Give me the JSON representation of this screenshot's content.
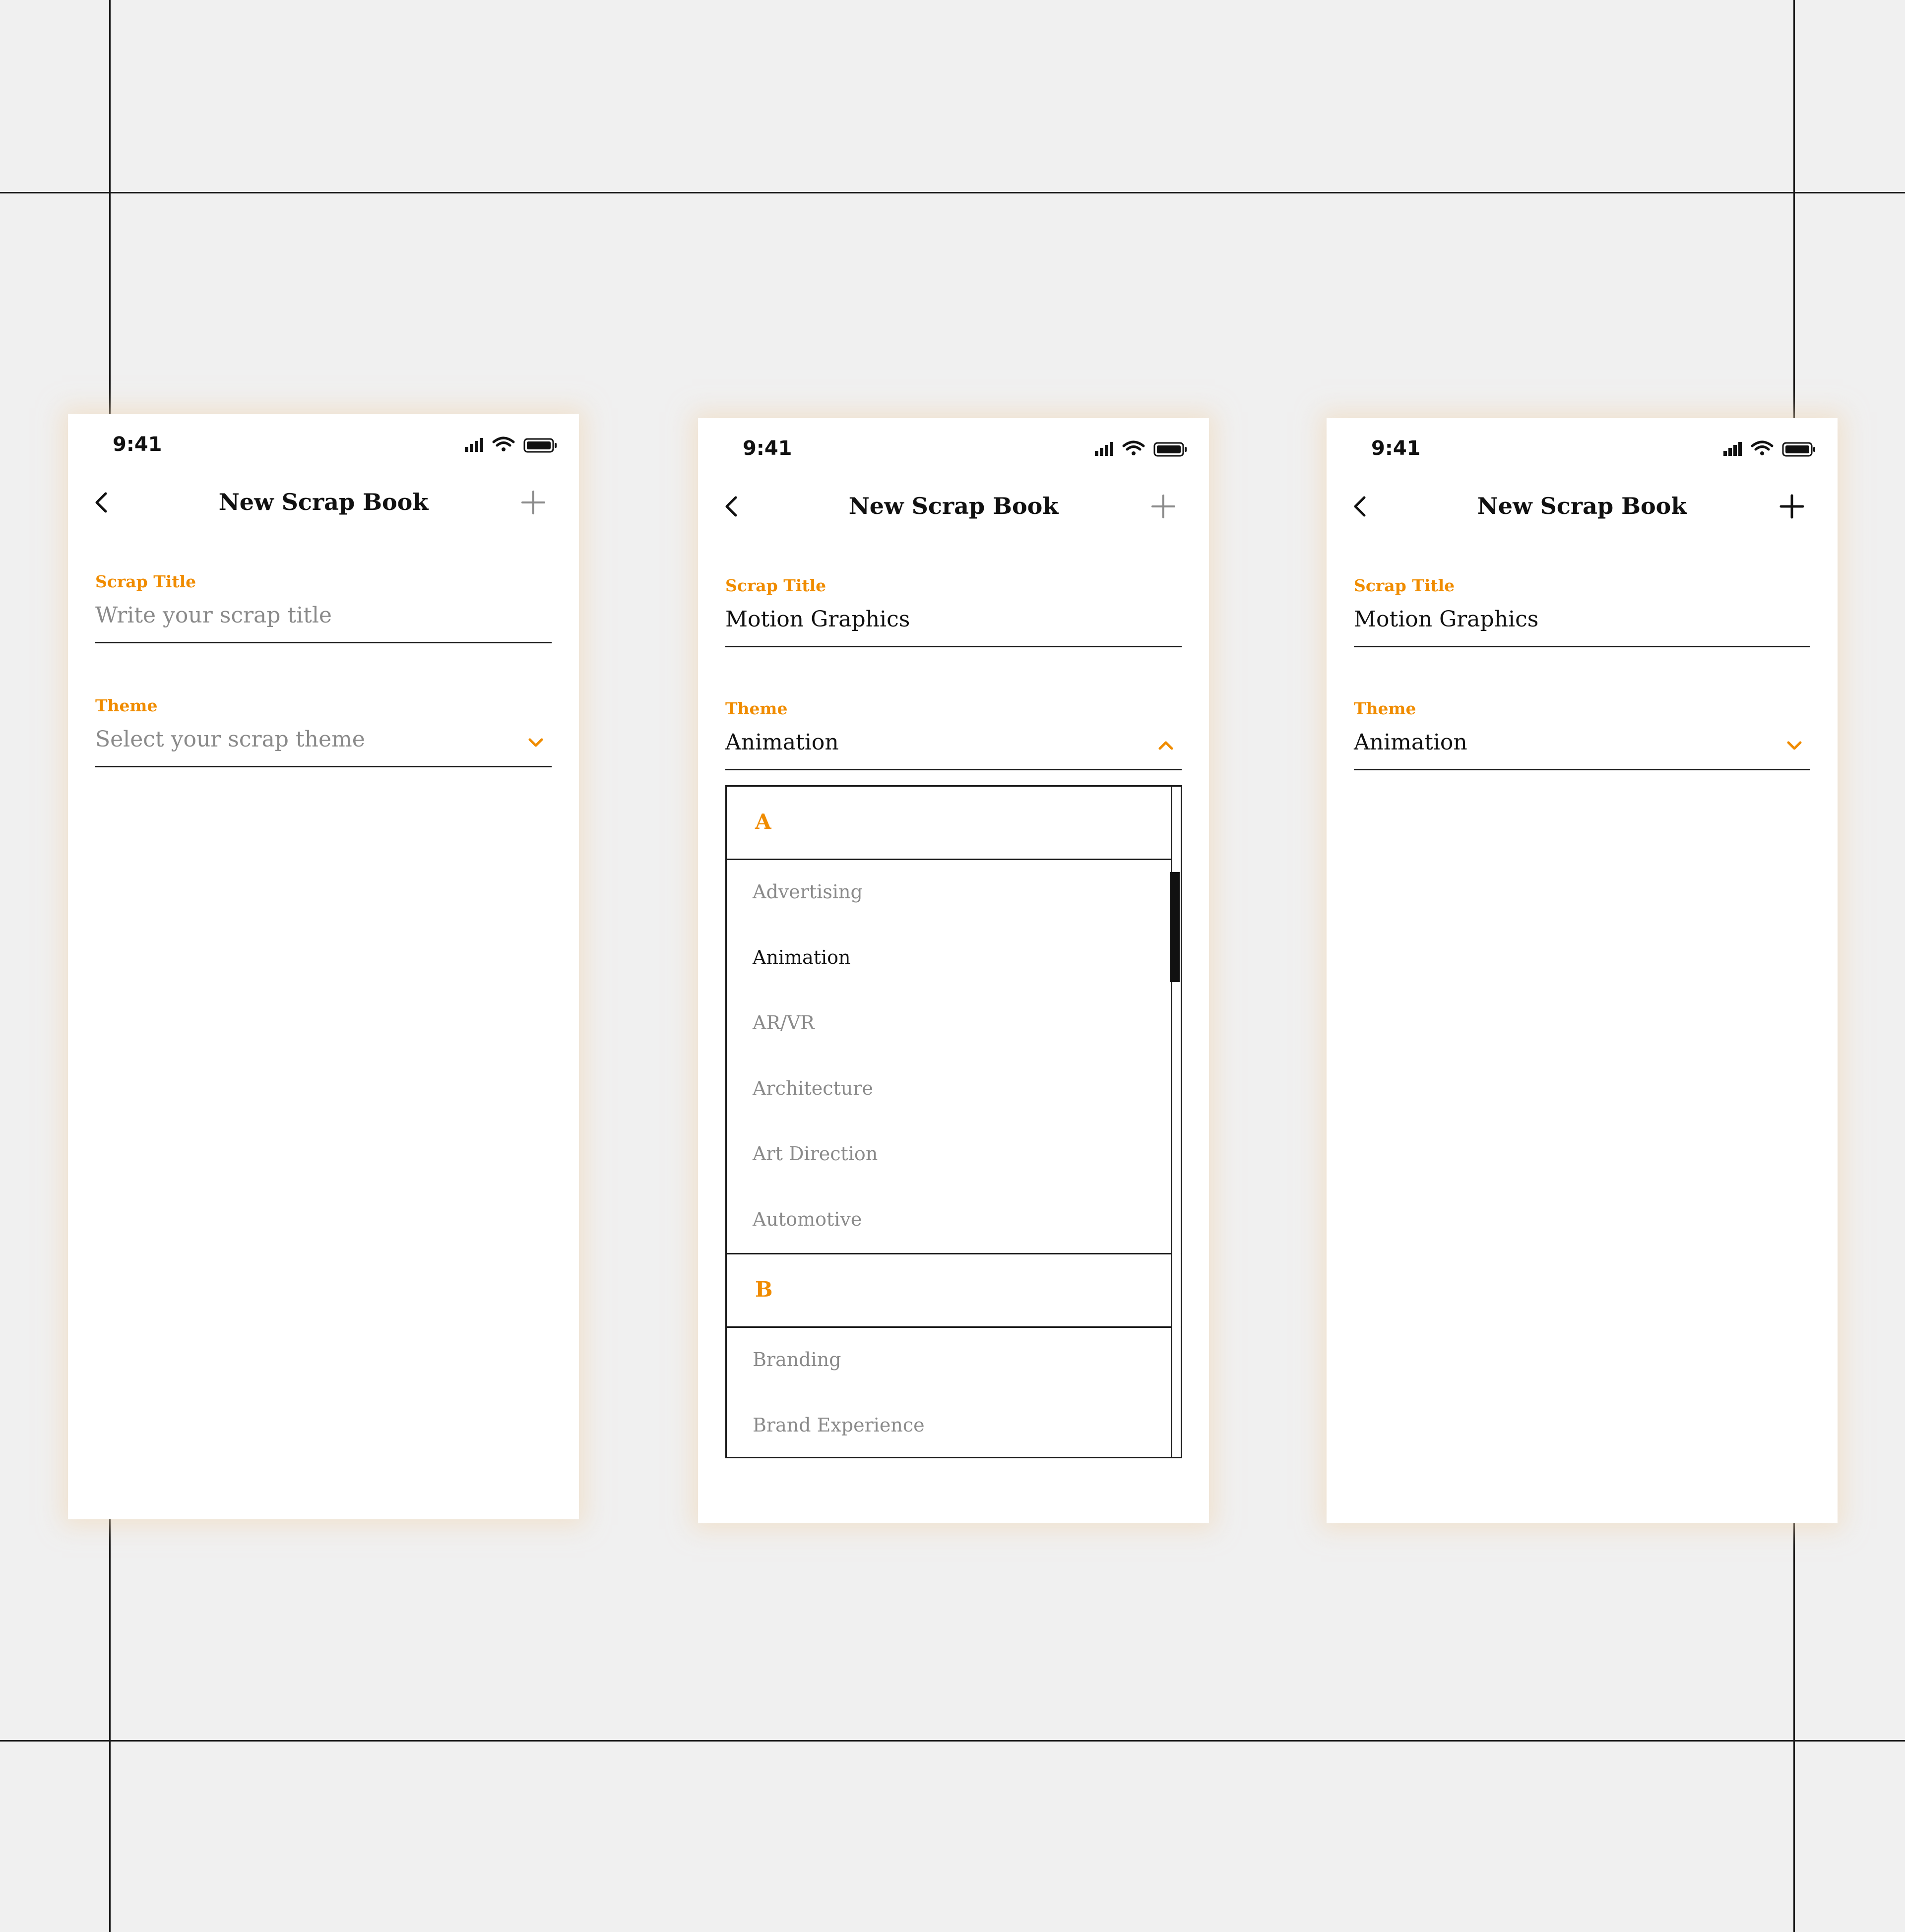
{
  "screens": [
    {
      "status_time": "9:41",
      "nav": {
        "title": "New Scrap Book",
        "add_icon": "plus-icon",
        "back_icon": "chevron-left-icon",
        "add_color": "#8a8a8a"
      },
      "title_field": {
        "label": "Scrap Title",
        "value": "",
        "placeholder": "Write your scrap title"
      },
      "theme_field": {
        "label": "Theme",
        "value": "",
        "placeholder": "Select your scrap theme",
        "chevron": "chevron-down-icon"
      }
    },
    {
      "status_time": "9:41",
      "nav": {
        "title": "New Scrap Book",
        "add_icon": "plus-icon",
        "back_icon": "chevron-left-icon",
        "add_color": "#8a8a8a"
      },
      "title_field": {
        "label": "Scrap Title",
        "value": "Motion Graphics"
      },
      "theme_field": {
        "label": "Theme",
        "value": "Animation",
        "chevron": "chevron-up-icon"
      },
      "dropdown": {
        "groups": [
          {
            "letter": "A",
            "items": [
              "Advertising",
              "Animation",
              "AR/VR",
              "Architecture",
              "Art Direction",
              "Automotive"
            ]
          },
          {
            "letter": "B",
            "items": [
              "Branding",
              "Brand Experience"
            ]
          }
        ],
        "selected": "Animation"
      }
    },
    {
      "status_time": "9:41",
      "nav": {
        "title": "New Scrap Book",
        "add_icon": "plus-icon",
        "back_icon": "chevron-left-icon",
        "add_color": "#111111"
      },
      "title_field": {
        "label": "Scrap Title",
        "value": "Motion Graphics"
      },
      "theme_field": {
        "label": "Theme",
        "value": "Animation",
        "chevron": "chevron-down-icon"
      }
    }
  ],
  "colors": {
    "accent": "#f08c00",
    "text": "#111111",
    "muted": "#8a8a8a",
    "line": "#1a1a1a",
    "canvas": "#f0f0f0"
  }
}
